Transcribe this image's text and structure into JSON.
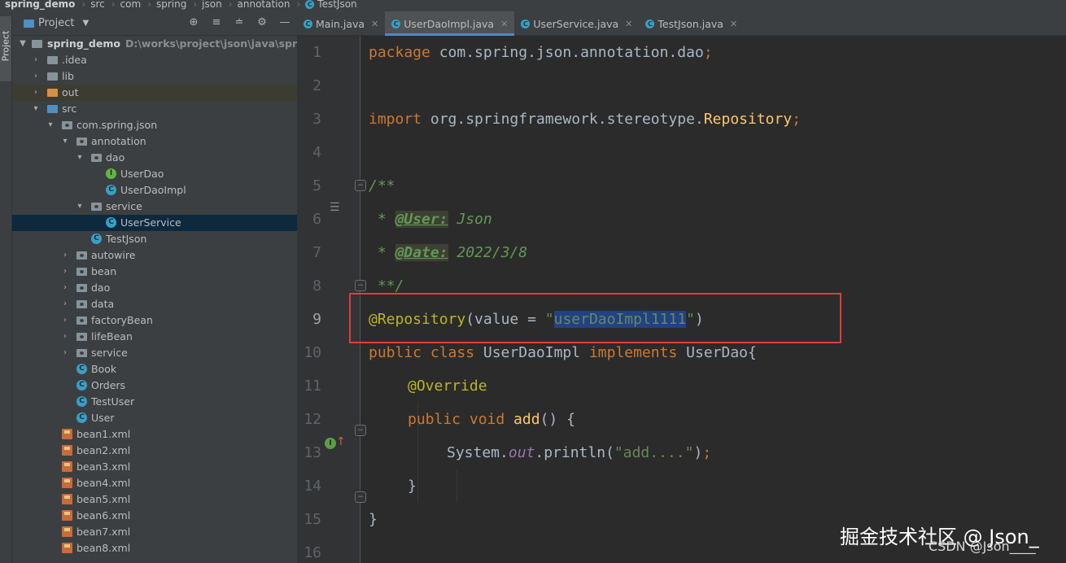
{
  "breadcrumb": [
    "spring_demo",
    "src",
    "com",
    "spring",
    "json",
    "annotation",
    "TestJson"
  ],
  "strip": {
    "label": "Project"
  },
  "project_panel": {
    "title": "Project"
  },
  "tree": [
    {
      "label": "spring_demo",
      "path": "D:\\works\\project\\json\\java\\spring_demo"
    },
    {
      "label": ".idea"
    },
    {
      "label": "lib"
    },
    {
      "label": "out"
    },
    {
      "label": "src"
    },
    {
      "label": "com.spring.json"
    },
    {
      "label": "annotation"
    },
    {
      "label": "dao"
    },
    {
      "label": "UserDao"
    },
    {
      "label": "UserDaoImpl"
    },
    {
      "label": "service"
    },
    {
      "label": "UserService"
    },
    {
      "label": "TestJson"
    },
    {
      "label": "autowire"
    },
    {
      "label": "bean"
    },
    {
      "label": "dao"
    },
    {
      "label": "data"
    },
    {
      "label": "factoryBean"
    },
    {
      "label": "lifeBean"
    },
    {
      "label": "service"
    },
    {
      "label": "Book"
    },
    {
      "label": "Orders"
    },
    {
      "label": "TestUser"
    },
    {
      "label": "User"
    },
    {
      "label": "bean1.xml"
    },
    {
      "label": "bean2.xml"
    },
    {
      "label": "bean3.xml"
    },
    {
      "label": "bean4.xml"
    },
    {
      "label": "bean5.xml"
    },
    {
      "label": "bean6.xml"
    },
    {
      "label": "bean7.xml"
    },
    {
      "label": "bean8.xml"
    }
  ],
  "tabs": [
    "Main.java",
    "UserDaoImpl.java",
    "UserService.java",
    "TestJson.java"
  ],
  "line_numbers": [
    "1",
    "2",
    "3",
    "4",
    "5",
    "6",
    "7",
    "8",
    "9",
    "10",
    "11",
    "12",
    "13",
    "14",
    "15",
    "16"
  ],
  "code": {
    "l1_kw": "package",
    "l1_rest": " com.spring.json.annotation.dao",
    "l1_semi": ";",
    "l3_kw": "import",
    "l3_rest": " org.springframework.stereotype.",
    "l3_cls": "Repository",
    "l3_semi": ";",
    "l5": "/**",
    "l6_pre": " * ",
    "l6_tag": "@User:",
    "l6_val": " Json",
    "l7_pre": " * ",
    "l7_tag": "@Date:",
    "l7_val": " 2022/3/8",
    "l8": " **/",
    "l9_ann": "@Repository",
    "l9_mid": "(value = ",
    "l9_q1": "\"",
    "l9_sel": "userDaoImpl1111",
    "l9_q2": "\"",
    "l9_end": ")",
    "l10_kw1": "public class",
    "l10_name": " UserDaoImpl ",
    "l10_kw2": "implements",
    "l10_rest": " UserDao{",
    "l11": "@Override",
    "l12_kw": "public void",
    "l12_fn": " add",
    "l12_rest": "() {",
    "l13_a": "System.",
    "l13_b": "out",
    "l13_c": ".println(",
    "l13_str": "\"add....\"",
    "l13_d": ")",
    "l13_e": ";",
    "l14": "}",
    "l15": "}"
  },
  "watermark": {
    "main": "掘金技术社区 @ Json_",
    "sub": "CSDN @Json____"
  }
}
